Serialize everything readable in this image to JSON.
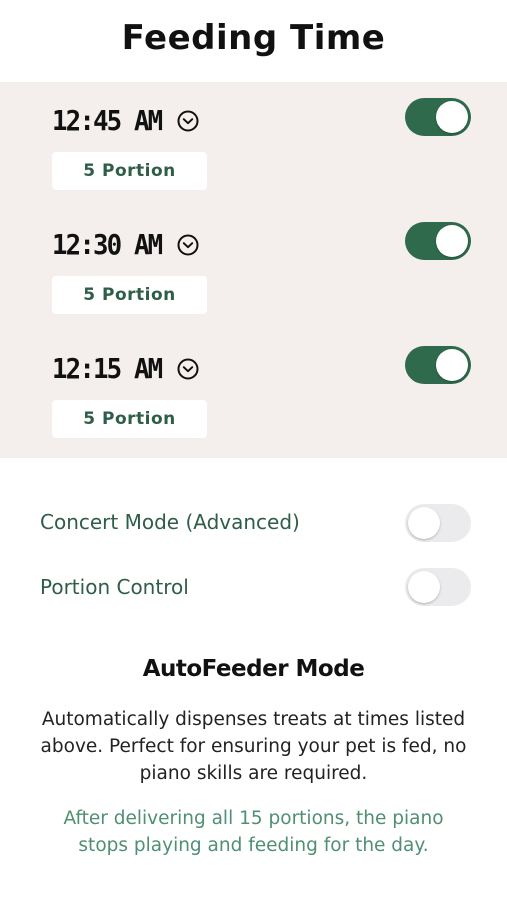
{
  "header": {
    "title": "Feeding Time"
  },
  "schedule": [
    {
      "time": "12:45 AM",
      "portion": "5 Portion",
      "enabled": true
    },
    {
      "time": "12:30 AM",
      "portion": "5 Portion",
      "enabled": true
    },
    {
      "time": "12:15 AM",
      "portion": "5 Portion",
      "enabled": true
    }
  ],
  "settings": {
    "concert_mode": {
      "label": "Concert Mode (Advanced)",
      "enabled": false
    },
    "portion_control": {
      "label": "Portion Control",
      "enabled": false
    }
  },
  "mode": {
    "title": "AutoFeeder Mode",
    "description": "Automatically dispenses treats at times listed above. Perfect for ensuring your pet is fed, no piano skills are required.",
    "note": "After delivering all 15 portions, the piano stops playing and feeding for the day."
  },
  "colors": {
    "accent": "#2f6a4c",
    "label_green": "#2f5e48",
    "note_green": "#4f8f72",
    "panel_bg": "#f4eeec",
    "toggle_off": "#ebebee"
  },
  "icons": {
    "time_dropdown": "chevron-down-circle-icon"
  }
}
